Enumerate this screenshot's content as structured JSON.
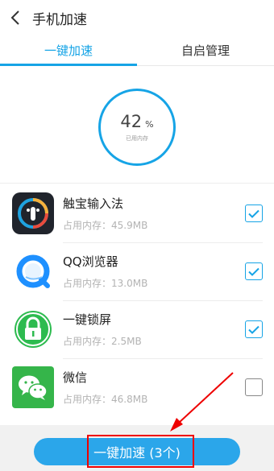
{
  "header": {
    "title": "手机加速",
    "back_icon": "chevron-left-icon"
  },
  "tabs": [
    {
      "label": "一键加速",
      "active": true
    },
    {
      "label": "自启管理",
      "active": false
    }
  ],
  "memory": {
    "value": "42",
    "unit": "%",
    "caption": "已用内存",
    "percent": 42
  },
  "apps": [
    {
      "name": "触宝输入法",
      "mem": "占用内存：45.9MB",
      "checked": true,
      "icon": "touchpal-icon"
    },
    {
      "name": "QQ浏览器",
      "mem": "占用内存：13.0MB",
      "checked": true,
      "icon": "qq-browser-icon"
    },
    {
      "name": "一键锁屏",
      "mem": "占用内存：2.5MB",
      "checked": true,
      "icon": "lock-screen-icon"
    },
    {
      "name": "微信",
      "mem": "占用内存：46.8MB",
      "checked": false,
      "icon": "wechat-icon"
    }
  ],
  "action": {
    "label": "一键加速 (3个)"
  },
  "colors": {
    "accent": "#16a4e6",
    "button": "#2ba6ea",
    "annotation": "#ee0000"
  }
}
